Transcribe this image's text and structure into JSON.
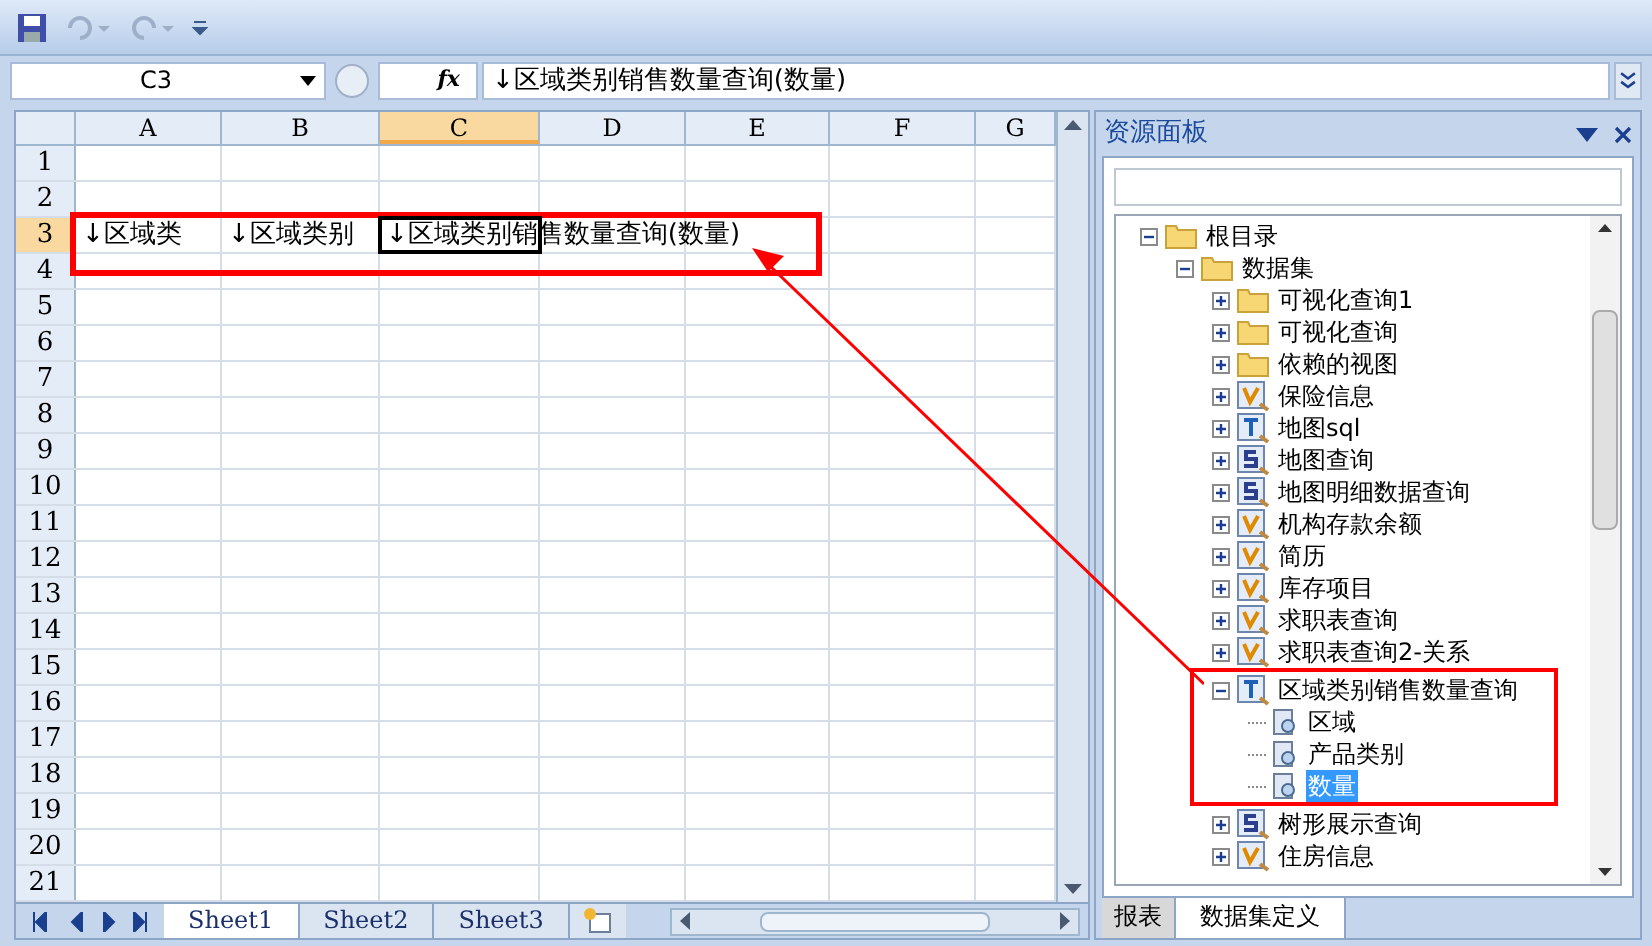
{
  "formula_bar": {
    "cell_ref": "C3",
    "fx": "fx",
    "formula": "↓区域类别销售数量查询(数量)"
  },
  "sheet": {
    "columns": [
      {
        "label": "A",
        "selected": false
      },
      {
        "label": "B",
        "selected": false
      },
      {
        "label": "C",
        "selected": true
      },
      {
        "label": "D",
        "selected": false
      },
      {
        "label": "E",
        "selected": false
      },
      {
        "label": "F",
        "selected": false
      },
      {
        "label": "G",
        "selected": false
      }
    ],
    "rows": [
      {
        "label": "1",
        "selected": false
      },
      {
        "label": "2",
        "selected": false
      },
      {
        "label": "3",
        "selected": true,
        "cells": [
          "↓区域类",
          "↓区域类别",
          "↓区域类别销售数量查询(数量)"
        ]
      },
      {
        "label": "4",
        "selected": false
      },
      {
        "label": "5",
        "selected": false
      },
      {
        "label": "6",
        "selected": false
      },
      {
        "label": "7",
        "selected": false
      },
      {
        "label": "8",
        "selected": false
      },
      {
        "label": "9",
        "selected": false
      },
      {
        "label": "10",
        "selected": false
      },
      {
        "label": "11",
        "selected": false
      },
      {
        "label": "12",
        "selected": false
      },
      {
        "label": "13",
        "selected": false
      },
      {
        "label": "14",
        "selected": false
      },
      {
        "label": "15",
        "selected": false
      },
      {
        "label": "16",
        "selected": false
      },
      {
        "label": "17",
        "selected": false
      },
      {
        "label": "18",
        "selected": false
      },
      {
        "label": "19",
        "selected": false
      },
      {
        "label": "20",
        "selected": false
      },
      {
        "label": "21",
        "selected": false
      }
    ],
    "tabs": [
      {
        "label": "Sheet1",
        "selected": true
      },
      {
        "label": "Sheet2",
        "selected": false
      },
      {
        "label": "Sheet3",
        "selected": false
      }
    ]
  },
  "panel": {
    "title": "资源面板",
    "tree": [
      {
        "label": "根目录",
        "kind": "folder",
        "expanded": true,
        "selected": false,
        "children": [
          {
            "label": "数据集",
            "kind": "folder",
            "expanded": true,
            "selected": false,
            "children": [
              {
                "label": "可视化查询1",
                "kind": "folder",
                "expanded": false,
                "selected": false
              },
              {
                "label": "可视化查询",
                "kind": "folder",
                "expanded": false,
                "selected": false
              },
              {
                "label": "依赖的视图",
                "kind": "folder",
                "expanded": false,
                "selected": false
              },
              {
                "label": "保险信息",
                "kind": "v",
                "expanded": false,
                "selected": false
              },
              {
                "label": "地图sql",
                "kind": "t",
                "expanded": false,
                "selected": false
              },
              {
                "label": "地图查询",
                "kind": "s",
                "expanded": false,
                "selected": false
              },
              {
                "label": "地图明细数据查询",
                "kind": "s",
                "expanded": false,
                "selected": false
              },
              {
                "label": "机构存款余额",
                "kind": "v",
                "expanded": false,
                "selected": false
              },
              {
                "label": "简历",
                "kind": "v",
                "expanded": false,
                "selected": false
              },
              {
                "label": "库存项目",
                "kind": "v",
                "expanded": false,
                "selected": false
              },
              {
                "label": "求职表查询",
                "kind": "v",
                "expanded": false,
                "selected": false
              },
              {
                "label": "求职表查询2-关系",
                "kind": "v",
                "expanded": false,
                "selected": false
              },
              {
                "label": "区域类别销售数量查询",
                "kind": "t",
                "expanded": true,
                "selected": false,
                "children": [
                  {
                    "label": "区域",
                    "kind": "field",
                    "selected": false
                  },
                  {
                    "label": "产品类别",
                    "kind": "field",
                    "selected": false
                  },
                  {
                    "label": "数量",
                    "kind": "field",
                    "selected": true
                  }
                ]
              },
              {
                "label": "树形展示查询",
                "kind": "s",
                "expanded": false,
                "selected": false
              },
              {
                "label": "住房信息",
                "kind": "v",
                "expanded": false,
                "selected": false
              }
            ]
          }
        ]
      }
    ],
    "tabs": [
      {
        "label": "报表",
        "selected": false
      },
      {
        "label": "数据集定义",
        "selected": true
      }
    ]
  }
}
